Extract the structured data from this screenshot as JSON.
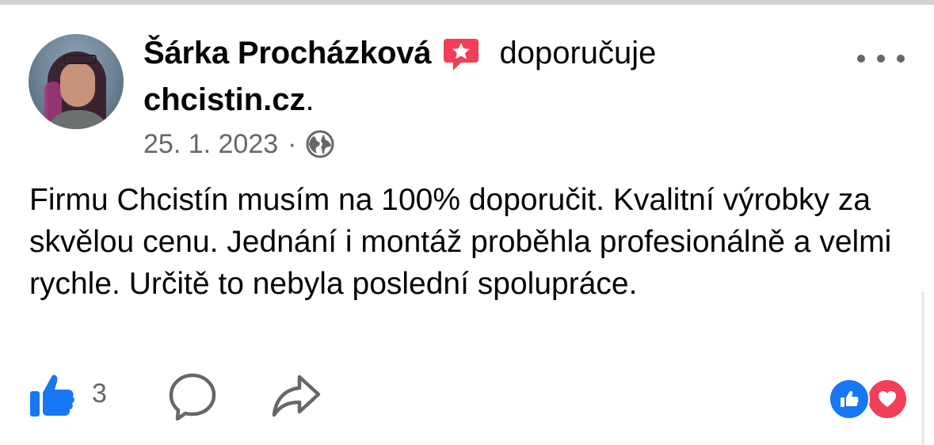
{
  "post": {
    "author_name": "Šárka Procházková",
    "verb": "doporučuje",
    "page_name": "chcistin.cz",
    "page_suffix": ".",
    "date": "25. 1. 2023",
    "separator": "·",
    "privacy_icon": "globe-icon",
    "recommend_icon": "recommend-star-icon",
    "menu_icon": "more-options-icon",
    "text": "Firmu Chcistín musím na 100% doporučit. Kvalitní výrobky za skvělou cenu. Jednání i montáž proběhla profesionálně a velmi rychle. Určitě to nebyla poslední spolupráce."
  },
  "actions": {
    "like_count": "3",
    "like_icon": "thumbs-up-icon",
    "comment_icon": "comment-icon",
    "share_icon": "share-icon"
  },
  "reactions": [
    "like",
    "love"
  ],
  "colors": {
    "like_blue": "#1877f2",
    "love_red": "#f33e58",
    "recommend_pink": "#f33e58",
    "secondary_text": "#65676b"
  }
}
